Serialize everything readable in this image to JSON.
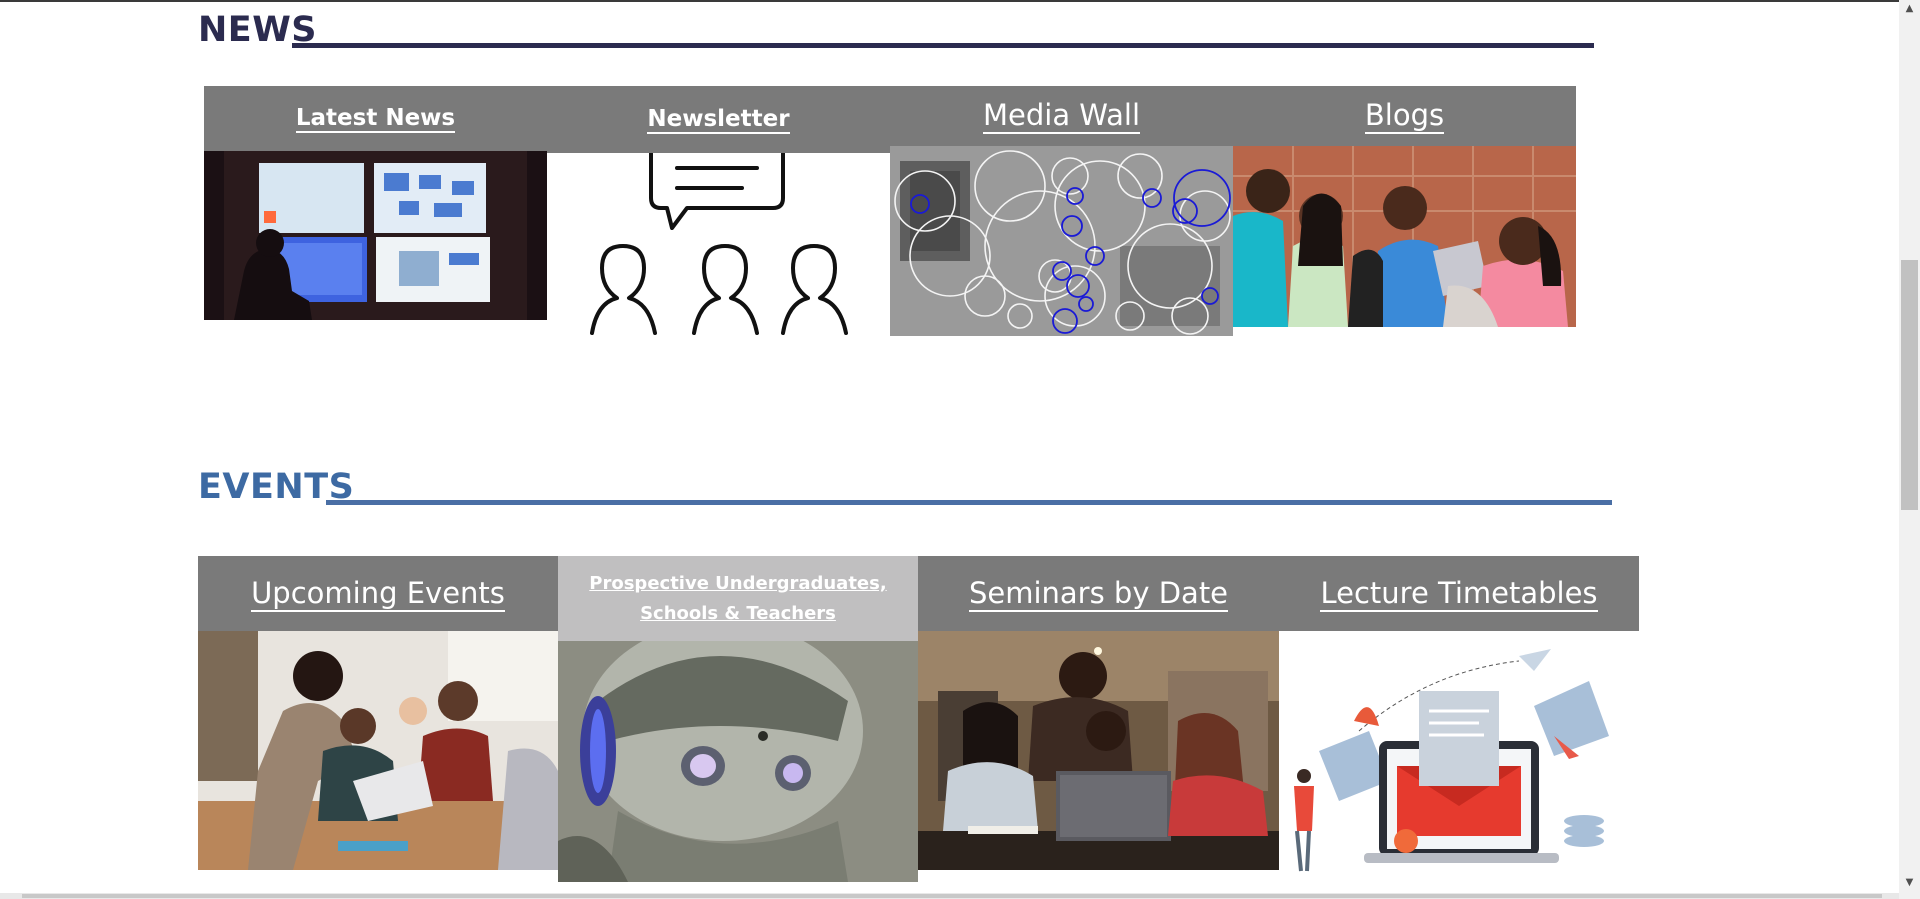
{
  "news": {
    "title": "NEWS",
    "rule_color": "#2b2b4f",
    "tiles": [
      {
        "label": "Latest News",
        "image": "monitoring-room-photo"
      },
      {
        "label": "Newsletter",
        "image": "speech-bubble-people-icon"
      },
      {
        "label": "Media Wall",
        "image": "circles-overlay-photo"
      },
      {
        "label": "Blogs",
        "image": "students-laptop-photo"
      }
    ]
  },
  "events": {
    "title": "EVENTS",
    "rule_color": "#4a6fa5",
    "tiles": [
      {
        "label": "Upcoming Events",
        "image": "classroom-photo"
      },
      {
        "label": "Prospective Undergraduates, Schools & Teachers",
        "image": "robot-photo"
      },
      {
        "label": "Seminars by Date",
        "image": "students-computer-photo"
      },
      {
        "label": "Lecture Timetables",
        "image": "email-laptop-illustration"
      }
    ]
  },
  "colors": {
    "header_gray": "#7a7a7a",
    "header_light": "#c0bfc0",
    "news_title": "#2b2b4f",
    "events_title": "#3d6aa3"
  }
}
